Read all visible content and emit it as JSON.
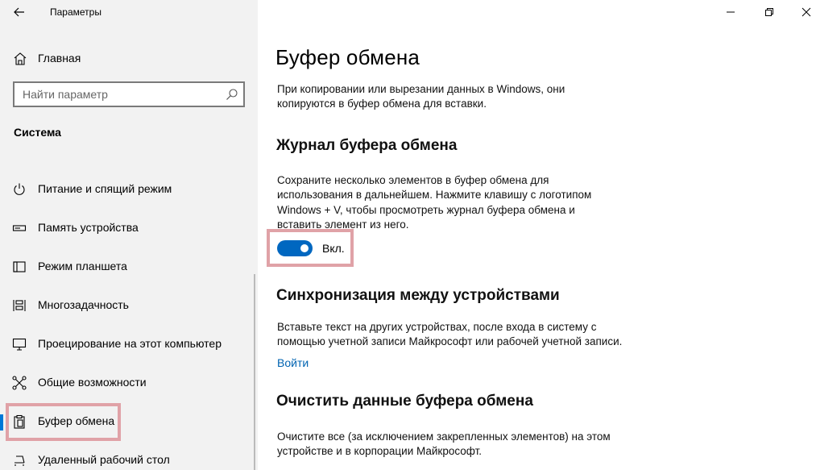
{
  "app": {
    "title": "Параметры"
  },
  "sidebar": {
    "home_label": "Главная",
    "search_placeholder": "Найти параметр",
    "section_title": "Система",
    "items": [
      {
        "label": "Питание и спящий режим",
        "icon": "power-icon"
      },
      {
        "label": "Память устройства",
        "icon": "storage-icon"
      },
      {
        "label": "Режим планшета",
        "icon": "tablet-icon"
      },
      {
        "label": "Многозадачность",
        "icon": "multitasking-icon"
      },
      {
        "label": "Проецирование на этот компьютер",
        "icon": "project-icon"
      },
      {
        "label": "Общие возможности",
        "icon": "shared-experiences-icon"
      },
      {
        "label": "Буфер обмена",
        "icon": "clipboard-icon",
        "active": true
      },
      {
        "label": "Удаленный рабочий стол",
        "icon": "remote-desktop-icon"
      }
    ]
  },
  "main": {
    "title": "Буфер обмена",
    "intro": "При копировании или вырезании данных в Windows, они копируются в буфер обмена для вставки.",
    "history": {
      "heading": "Журнал буфера обмена",
      "description": "Сохраните несколько элементов в буфер обмена для использования в дальнейшем. Нажмите клавишу с логотипом Windows + V, чтобы просмотреть журнал буфера обмена и вставить элемент из него.",
      "toggle_label": "Вкл.",
      "toggle_on": true
    },
    "sync": {
      "heading": "Синхронизация между устройствами",
      "description": "Вставьте текст на других устройствах, после входа в систему с помощью учетной записи Майкрософт или рабочей учетной записи.",
      "link_label": "Войти"
    },
    "clear": {
      "heading": "Очистить данные буфера обмена",
      "description": "Очистите все (за исключением закрепленных элементов) на этом устройстве и в корпорации Майкрософт."
    }
  },
  "colors": {
    "accent": "#0067c0",
    "highlight": "#e0a2a7",
    "link": "#0063b1",
    "sidebar_bg": "#f2f2f2"
  }
}
